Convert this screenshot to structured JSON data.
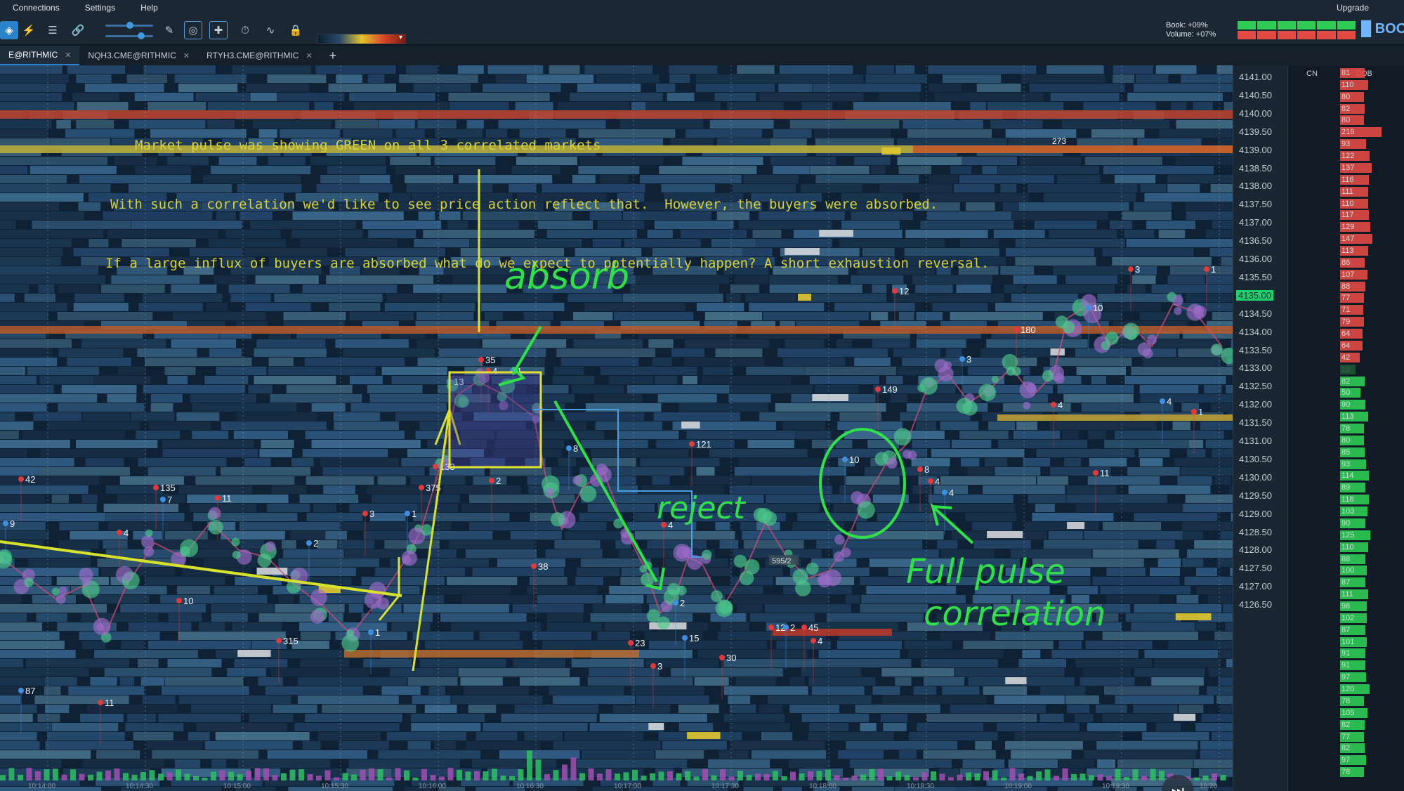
{
  "menu": {
    "items": [
      "Connections",
      "Settings",
      "Help"
    ],
    "upgrade": "Upgrade"
  },
  "toolbar": {
    "book_label": "Book: +09%",
    "volume_label": "Volume: +07%",
    "brand": "BOO",
    "pulse_colors": [
      "#2ecc55",
      "#2ecc55",
      "#2ecc55",
      "#e24a43",
      "#e24a43",
      "#e24a43"
    ]
  },
  "tabs": [
    {
      "label": "E@RITHMIC",
      "active": true
    },
    {
      "label": "NQH3.CME@RITHMIC",
      "active": false
    },
    {
      "label": "RTYH3.CME@RITHMIC",
      "active": false
    }
  ],
  "annotations": {
    "line1": "Market pulse was showing GREEN on all 3 correlated markets",
    "line2": "With such a correlation we'd like to see price action reflect that.  However, the buyers were absorbed.",
    "line3": "If a large influx of buyers are absorbed what do we expect to potentially happen? A short exhaustion reversal.",
    "absorb": "absorb",
    "reject": "reject",
    "full_pulse_1": "Full pulse",
    "full_pulse_2": "correlation",
    "large_order": "273",
    "box_label": "595/2"
  },
  "price_axis": {
    "prices": [
      "4141.00",
      "4140.50",
      "4140.00",
      "4139.50",
      "4139.00",
      "4138.50",
      "4138.00",
      "4137.50",
      "4137.00",
      "4136.50",
      "4136.00",
      "4135.50",
      "4135.00",
      "4134.50",
      "4134.00",
      "4133.50",
      "4133.00",
      "4132.50",
      "4132.00",
      "4131.50",
      "4131.00",
      "4130.50",
      "4130.00",
      "4129.50",
      "4129.00",
      "4128.50",
      "4128.00",
      "4127.50",
      "4127.00",
      "4126.50"
    ],
    "current": "4135.00"
  },
  "side_panel": {
    "col1": "CN",
    "col2": "COB",
    "cob_values": [
      "81",
      "110",
      "80",
      "82",
      "80",
      "216",
      "93",
      "122",
      "137",
      "116",
      "111",
      "110",
      "117",
      "129",
      "147",
      "113",
      "86",
      "107",
      "88",
      "77",
      "71",
      "79",
      "64",
      "64",
      "42",
      "10",
      "82",
      "50",
      "90",
      "113",
      "78",
      "80",
      "85",
      "93",
      "114",
      "89",
      "118",
      "103",
      "90",
      "125",
      "110",
      "88",
      "100",
      "87",
      "111",
      "98",
      "102",
      "87",
      "101",
      "91",
      "91",
      "97",
      "120",
      "78",
      "105",
      "82",
      "77",
      "82",
      "97",
      "78"
    ],
    "cob_colors": {
      "ask": "#e24a43",
      "bid": "#2ecc55"
    }
  },
  "trade_labels": [
    {
      "t": "9"
    },
    {
      "t": "42"
    },
    {
      "t": "135"
    },
    {
      "t": "7"
    },
    {
      "t": "11"
    },
    {
      "t": "4"
    },
    {
      "t": "2"
    },
    {
      "t": "10"
    },
    {
      "t": "3"
    },
    {
      "t": "1"
    },
    {
      "t": "375"
    },
    {
      "t": "133"
    },
    {
      "t": "13"
    },
    {
      "t": "35"
    },
    {
      "t": "4"
    },
    {
      "t": "1"
    },
    {
      "t": "2"
    },
    {
      "t": "38"
    },
    {
      "t": "8"
    },
    {
      "t": "121"
    },
    {
      "t": "4"
    },
    {
      "t": "2"
    },
    {
      "t": "23"
    },
    {
      "t": "3"
    },
    {
      "t": "15"
    },
    {
      "t": "30"
    },
    {
      "t": "12"
    },
    {
      "t": "2"
    },
    {
      "t": "45"
    },
    {
      "t": "4"
    },
    {
      "t": "10"
    },
    {
      "t": "8"
    },
    {
      "t": "4"
    },
    {
      "t": "4"
    },
    {
      "t": "149"
    },
    {
      "t": "12"
    },
    {
      "t": "3"
    },
    {
      "t": "180"
    },
    {
      "t": "4"
    },
    {
      "t": "10"
    },
    {
      "t": "11"
    },
    {
      "t": "3"
    },
    {
      "t": "4"
    },
    {
      "t": "1"
    },
    {
      "t": "1"
    },
    {
      "t": "87"
    },
    {
      "t": "11"
    },
    {
      "t": "315"
    },
    {
      "t": "1"
    }
  ],
  "time_labels": [
    "10:14:00",
    "10:14:30",
    "10:15:00",
    "10:15:30",
    "10:16:00",
    "10:16:30",
    "10:17:00",
    "10:17:30",
    "10:18:00",
    "10:18:30",
    "10:19:00",
    "10:19:30",
    "10:20"
  ]
}
